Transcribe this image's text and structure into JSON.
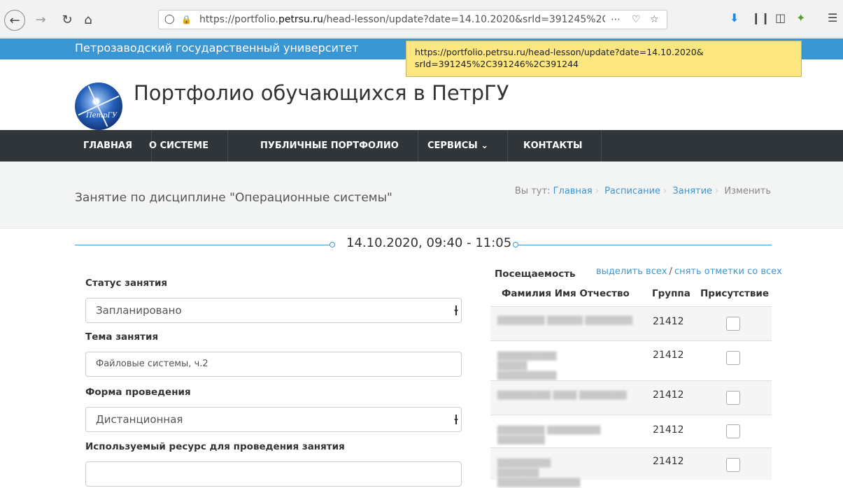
{
  "browser": {
    "url_prefix": "https://portfolio.",
    "url_domain": "petrsu.ru",
    "url_rest": "/head-lesson/update?date=14.10.2020&srId=391245%2C3",
    "icons": [
      "back-icon",
      "forward-icon",
      "reload-icon",
      "home-icon",
      "shield-icon",
      "lock-icon",
      "more-icon",
      "pocket-icon",
      "star-icon",
      "download-icon",
      "library-icon",
      "sidebar-icon",
      "extension-icon",
      "menu-icon"
    ]
  },
  "tooltip": {
    "line1": "https://portfolio.petrsu.ru/head-lesson/update?date=14.10.2020&",
    "line2": "srId=391245%2C391246%2C391244"
  },
  "site": {
    "university": "Петрозаводский государственный университет",
    "logo_text": "ПетрГУ",
    "title": "Портфолио обучающихся в ПетрГУ"
  },
  "nav": {
    "home": "ГЛАВНАЯ",
    "about": "О СИСТЕМЕ",
    "public": "ПУБЛИЧНЫЕ ПОРТФОЛИО",
    "services": "СЕРВИСЫ ⌄",
    "contacts": "КОНТАКТЫ"
  },
  "page": {
    "title": "Занятие по дисциплине \"Операционные системы\"",
    "breadcrumb": {
      "prefix": "Вы тут:",
      "home": "Главная",
      "schedule": "Расписание",
      "lesson": "Занятие",
      "current": "Изменить"
    },
    "date_heading": "14.10.2020, 09:40 - 11:05"
  },
  "form": {
    "status_label": "Статус занятия",
    "status_value": "Запланировано",
    "topic_label": "Тема занятия",
    "topic_value": "Файловые системы, ч.2",
    "form_label": "Форма проведения",
    "form_value": "Дистанционная",
    "resource_label": "Используемый ресурс для проведения занятия",
    "resource_value": ""
  },
  "attendance": {
    "title": "Посещаемость",
    "select_all": "выделить всех",
    "slash": "/",
    "clear_all": "снять отметки со всех",
    "columns": {
      "name": "Фамилия Имя Отчество",
      "group": "Группа",
      "present": "Присутствие"
    },
    "rows": [
      {
        "group": "21412",
        "present": false
      },
      {
        "group": "21412",
        "present": false
      },
      {
        "group": "21412",
        "present": false
      },
      {
        "group": "21412",
        "present": false
      },
      {
        "group": "21412",
        "present": false
      }
    ]
  }
}
